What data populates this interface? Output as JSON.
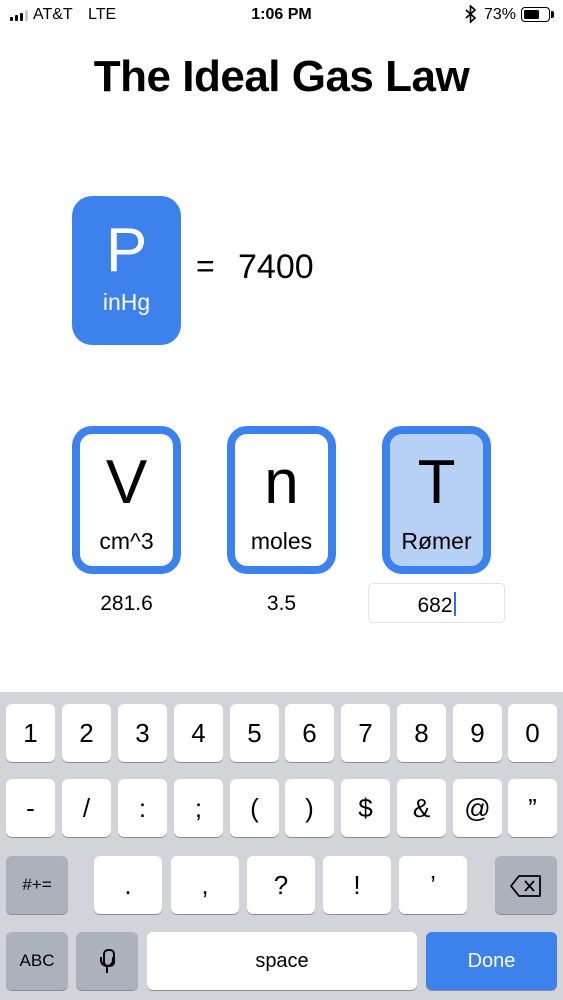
{
  "status_bar": {
    "carrier": "AT&T",
    "network": "LTE",
    "time": "1:06 PM",
    "bluetooth_icon": "bluetooth-icon",
    "battery_percent": "73%",
    "battery_level": 0.73
  },
  "title": "The Ideal Gas Law",
  "result_tile": {
    "symbol": "P",
    "unit": "inHg"
  },
  "equals_sign": "=",
  "result_value": "7400",
  "variables": [
    {
      "symbol": "V",
      "unit": "cm^3",
      "value": "281.6",
      "selected": false
    },
    {
      "symbol": "n",
      "unit": "moles",
      "value": "3.5",
      "selected": false
    },
    {
      "symbol": "T",
      "unit": "Rømer",
      "value": "682",
      "selected": true
    }
  ],
  "keyboard": {
    "row1": [
      "1",
      "2",
      "3",
      "4",
      "5",
      "6",
      "7",
      "8",
      "9",
      "0"
    ],
    "row2": [
      "-",
      "/",
      ":",
      ";",
      "(",
      ")",
      "$",
      "&",
      "@",
      "”"
    ],
    "row3": [
      ".",
      ",",
      "?",
      "!",
      "’"
    ],
    "symbols_key": "#+=",
    "backspace_icon": "backspace-icon",
    "abc_key": "ABC",
    "mic_icon": "microphone-icon",
    "space_key": "space",
    "done_key": "Done"
  },
  "colors": {
    "accent": "#3d82ec",
    "selected_fill": "#b6d0f6",
    "keyboard_bg": "#d1d4d9",
    "dark_key": "#acb2bb"
  }
}
